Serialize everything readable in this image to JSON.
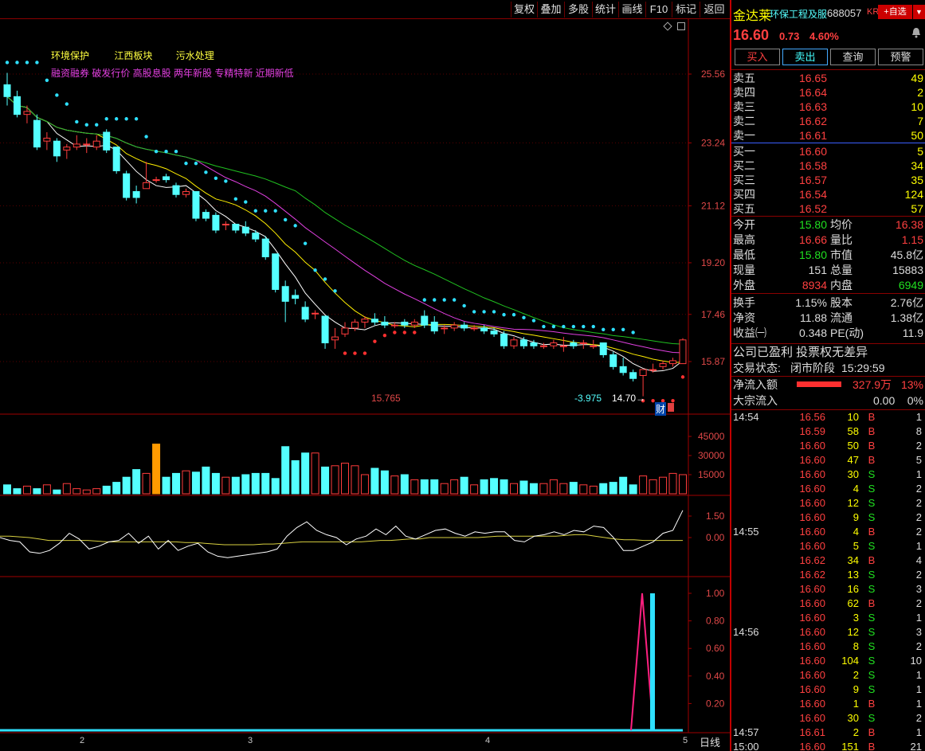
{
  "toolbar": {
    "items": [
      "复权",
      "叠加",
      "多股",
      "统计",
      "画线",
      "F10",
      "标记",
      "返回"
    ]
  },
  "chart_header": {
    "concepts": [
      "环境保护",
      "江西板块",
      "污水处理"
    ],
    "tags": "融资融券 破发行价 高股息股 两年新股 专精特新 近期新低"
  },
  "chart_annotations": {
    "low_marker": "15.765",
    "change_marker": "-3.975",
    "price_marker": "14.70→",
    "fin_badge": "财",
    "period": "日线",
    "dates": [
      "2",
      "3",
      "4",
      "5"
    ]
  },
  "chart_data": [
    {
      "type": "candlestick",
      "y_ticks": [
        "25.56",
        "23.24",
        "21.12",
        "19.20",
        "17.46",
        "15.87"
      ],
      "candles": [
        [
          25.2,
          25.6,
          24.5,
          24.8
        ],
        [
          24.8,
          25.0,
          24.1,
          24.2
        ],
        [
          24.2,
          24.5,
          23.9,
          24.3
        ],
        [
          24.0,
          24.2,
          23.0,
          23.1
        ],
        [
          23.3,
          23.6,
          23.0,
          23.4
        ],
        [
          23.3,
          23.4,
          22.6,
          22.8
        ],
        [
          23.0,
          23.2,
          22.7,
          23.1
        ],
        [
          23.1,
          23.5,
          23.0,
          23.2
        ],
        [
          23.2,
          23.4,
          22.9,
          23.2
        ],
        [
          23.1,
          23.5,
          23.0,
          23.3
        ],
        [
          23.6,
          23.7,
          22.9,
          23.0
        ],
        [
          23.1,
          23.1,
          22.2,
          22.3
        ],
        [
          22.2,
          22.3,
          21.3,
          21.4
        ],
        [
          21.6,
          21.8,
          21.2,
          21.4
        ],
        [
          21.7,
          22.6,
          21.7,
          21.9
        ],
        [
          22.0,
          22.1,
          21.9,
          22.0
        ],
        [
          22.1,
          22.2,
          21.9,
          22.0
        ],
        [
          21.8,
          21.9,
          21.4,
          21.5
        ],
        [
          21.5,
          21.7,
          21.4,
          21.6
        ],
        [
          21.6,
          21.6,
          20.6,
          20.7
        ],
        [
          20.9,
          21.0,
          20.6,
          20.7
        ],
        [
          20.8,
          20.9,
          20.2,
          20.3
        ],
        [
          20.5,
          20.6,
          20.3,
          20.5
        ],
        [
          20.5,
          20.5,
          20.2,
          20.3
        ],
        [
          20.4,
          20.6,
          20.1,
          20.2
        ],
        [
          20.2,
          20.3,
          19.9,
          20.0
        ],
        [
          20.0,
          20.1,
          19.3,
          19.4
        ],
        [
          19.5,
          19.5,
          18.2,
          18.3
        ],
        [
          18.4,
          18.6,
          17.2,
          17.9
        ],
        [
          18.1,
          18.3,
          17.8,
          18.0
        ],
        [
          17.7,
          17.9,
          17.2,
          17.3
        ],
        [
          17.5,
          17.6,
          17.3,
          17.5
        ],
        [
          17.4,
          17.4,
          16.3,
          16.5
        ],
        [
          16.6,
          17.0,
          16.3,
          16.7
        ],
        [
          16.8,
          17.2,
          16.7,
          17.0
        ],
        [
          17.0,
          17.3,
          16.9,
          17.2
        ],
        [
          17.2,
          17.4,
          17.0,
          17.3
        ],
        [
          17.3,
          17.5,
          17.1,
          17.2
        ],
        [
          17.2,
          17.4,
          17.0,
          17.1
        ],
        [
          17.1,
          17.2,
          17.0,
          17.1
        ],
        [
          17.2,
          17.3,
          17.0,
          17.1
        ],
        [
          17.1,
          17.3,
          17.0,
          17.2
        ],
        [
          17.4,
          17.6,
          17.0,
          17.1
        ],
        [
          17.2,
          17.4,
          16.8,
          16.9
        ],
        [
          17.0,
          17.1,
          16.8,
          17.0
        ],
        [
          17.0,
          17.2,
          16.9,
          17.1
        ],
        [
          17.1,
          17.2,
          16.9,
          17.0
        ],
        [
          17.0,
          17.1,
          16.9,
          17.0
        ],
        [
          17.0,
          17.1,
          16.8,
          16.9
        ],
        [
          16.9,
          17.0,
          16.7,
          16.8
        ],
        [
          16.8,
          16.9,
          16.3,
          16.4
        ],
        [
          16.4,
          16.7,
          16.3,
          16.6
        ],
        [
          16.6,
          16.7,
          16.3,
          16.4
        ],
        [
          16.5,
          16.6,
          16.3,
          16.4
        ],
        [
          16.4,
          16.5,
          16.3,
          16.4
        ],
        [
          16.4,
          16.6,
          16.3,
          16.5
        ],
        [
          16.4,
          16.7,
          16.2,
          16.4
        ],
        [
          16.5,
          16.6,
          16.3,
          16.4
        ],
        [
          16.5,
          16.6,
          16.3,
          16.5
        ],
        [
          16.4,
          16.6,
          16.3,
          16.4
        ],
        [
          16.5,
          16.5,
          16.0,
          16.1
        ],
        [
          16.1,
          16.2,
          15.6,
          15.7
        ],
        [
          15.7,
          16.0,
          15.4,
          15.5
        ],
        [
          15.5,
          15.6,
          15.2,
          15.3
        ],
        [
          15.4,
          15.6,
          14.7,
          15.6
        ],
        [
          15.6,
          15.8,
          15.5,
          15.6
        ],
        [
          15.7,
          15.9,
          15.6,
          15.8
        ],
        [
          15.8,
          16.0,
          15.7,
          15.9
        ],
        [
          15.8,
          16.66,
          15.8,
          16.6
        ]
      ]
    },
    {
      "type": "bar",
      "name": "volume",
      "y_ticks": [
        "45000",
        "30000",
        "15000"
      ],
      "values": [
        7,
        4,
        6,
        4,
        7,
        3,
        8,
        4,
        3,
        4,
        6,
        9,
        13,
        19,
        16,
        39,
        13,
        16,
        18,
        17,
        21,
        16,
        13,
        13,
        15,
        16,
        16,
        12,
        37,
        26,
        32,
        32,
        21,
        22,
        24,
        22,
        15,
        20,
        18,
        14,
        15,
        11,
        11,
        11,
        8,
        11,
        13,
        7,
        11,
        12,
        11,
        8,
        10,
        8,
        8,
        11,
        8,
        9,
        7,
        6,
        8,
        9,
        13,
        7,
        14,
        11,
        13,
        16,
        15,
        15,
        16
      ]
    },
    {
      "type": "line",
      "name": "indicator",
      "y_ticks": [
        "1.50",
        "0.00"
      ],
      "series_white": [
        0,
        -0.2,
        -0.3,
        -1.0,
        -1.1,
        -0.9,
        -0.4,
        0.3,
        -0.1,
        -0.8,
        -0.6,
        -0.3,
        -0.2,
        0.3,
        -0.4,
        0.1,
        -0.8,
        -0.2,
        -0.9,
        -0.6,
        -0.4,
        -1.0,
        -1.3,
        -1.4,
        -1.3,
        -1.2,
        -1.1,
        -1.0,
        -0.8,
        0.1,
        0.7,
        1.1,
        0.5,
        0.2,
        0.0,
        -0.5,
        -0.1,
        0.1,
        0.6,
        0.2,
        0.8,
        0.1,
        -0.1,
        0.2,
        0.5,
        0.6,
        0.3,
        0.1,
        0.4,
        0.3,
        0.4,
        0.4,
        -0.2,
        -0.3,
        0.1,
        0.2,
        0.4,
        0.2,
        0.5,
        0.4,
        0.8,
        0.7,
        0.0,
        -0.9,
        -0.9,
        -0.6,
        -0.3,
        0.3,
        0.5,
        1.9
      ],
      "series_yellow": [
        0.1,
        0.1,
        0.05,
        0,
        -0.1,
        -0.2,
        -0.2,
        -0.2,
        -0.2,
        -0.2,
        -0.25,
        -0.3,
        -0.3,
        -0.3,
        -0.3,
        -0.3,
        -0.3,
        -0.3,
        -0.3,
        -0.35,
        -0.35,
        -0.4,
        -0.45,
        -0.5,
        -0.5,
        -0.5,
        -0.5,
        -0.45,
        -0.45,
        -0.4,
        -0.35,
        -0.3,
        -0.3,
        -0.3,
        -0.3,
        -0.3,
        -0.3,
        -0.3,
        -0.25,
        -0.2,
        -0.2,
        -0.15,
        -0.1,
        -0.1,
        0,
        0,
        0,
        0,
        0,
        0,
        0.05,
        0.1,
        0.1,
        0.1,
        0.1,
        0.1,
        0.1,
        0.1,
        0.15,
        0.2,
        0.2,
        0.1,
        0,
        -0.1,
        -0.15,
        -0.15,
        -0.2,
        -0.2,
        -0.2,
        -0.2,
        -0.2
      ]
    },
    {
      "type": "line",
      "name": "signal",
      "y_ticks": [
        "1.00",
        "0.80",
        "0.60",
        "0.40",
        "0.20"
      ]
    }
  ],
  "quote": {
    "name": "金达莱",
    "sector": "环保工程及服",
    "code": "688057",
    "kr": "KR",
    "add_btn": "+自选",
    "price": "16.60",
    "change": "0.73",
    "pct": "4.60%",
    "actions": [
      "买入",
      "卖出",
      "查询",
      "预警"
    ],
    "asks": [
      {
        "l": "卖五",
        "p": "16.65",
        "v": "49"
      },
      {
        "l": "卖四",
        "p": "16.64",
        "v": "2"
      },
      {
        "l": "卖三",
        "p": "16.63",
        "v": "10"
      },
      {
        "l": "卖二",
        "p": "16.62",
        "v": "7"
      },
      {
        "l": "卖一",
        "p": "16.61",
        "v": "50"
      }
    ],
    "bids": [
      {
        "l": "买一",
        "p": "16.60",
        "v": "5"
      },
      {
        "l": "买二",
        "p": "16.58",
        "v": "34"
      },
      {
        "l": "买三",
        "p": "16.57",
        "v": "35"
      },
      {
        "l": "买四",
        "p": "16.54",
        "v": "124"
      },
      {
        "l": "买五",
        "p": "16.52",
        "v": "57"
      }
    ],
    "stats": [
      {
        "l1": "今开",
        "v1": "15.80",
        "c1": "#20e020",
        "l2": "均价",
        "v2": "16.38",
        "c2": "#ff4040"
      },
      {
        "l1": "最高",
        "v1": "16.66",
        "c1": "#ff4040",
        "l2": "量比",
        "v2": "1.15",
        "c2": "#ff4040"
      },
      {
        "l1": "最低",
        "v1": "15.80",
        "c1": "#20e020",
        "l2": "市值",
        "v2": "45.8亿",
        "c2": "#dddddd"
      },
      {
        "l1": "现量",
        "v1": "151",
        "c1": "#dddddd",
        "l2": "总量",
        "v2": "15883",
        "c2": "#dddddd"
      },
      {
        "l1": "外盘",
        "v1": "8934",
        "c1": "#ff4040",
        "l2": "内盘",
        "v2": "6949",
        "c2": "#20e020"
      }
    ],
    "stats2": [
      {
        "l1": "换手",
        "v1": "1.15%",
        "l2": "股本",
        "v2": "2.76亿"
      },
      {
        "l1": "净资",
        "v1": "11.88",
        "l2": "流通",
        "v2": "1.38亿"
      },
      {
        "l1": "收益㈠",
        "v1": "0.348",
        "l2": "PE(动)",
        "v2": "11.9"
      }
    ],
    "notice": "公司已盈利 投票权无差异",
    "trade_status_label": "交易状态:",
    "trade_status": "闭市阶段",
    "trade_time": "15:29:59",
    "inflow_label": "净流入额",
    "inflow": "327.9万",
    "inflow_pct": "13%",
    "block_label": "大宗流入",
    "block": "0.00",
    "block_pct": "0%"
  },
  "ticks": [
    {
      "t": "14:54",
      "p": "16.56",
      "v": "10",
      "s": "B",
      "n": "1"
    },
    {
      "t": "",
      "p": "16.59",
      "v": "58",
      "s": "B",
      "n": "8"
    },
    {
      "t": "",
      "p": "16.60",
      "v": "50",
      "s": "B",
      "n": "2"
    },
    {
      "t": "",
      "p": "16.60",
      "v": "47",
      "s": "B",
      "n": "5"
    },
    {
      "t": "",
      "p": "16.60",
      "v": "30",
      "s": "S",
      "n": "1"
    },
    {
      "t": "",
      "p": "16.60",
      "v": "4",
      "s": "S",
      "n": "2"
    },
    {
      "t": "",
      "p": "16.60",
      "v": "12",
      "s": "S",
      "n": "2"
    },
    {
      "t": "",
      "p": "16.60",
      "v": "9",
      "s": "S",
      "n": "2"
    },
    {
      "t": "14:55",
      "p": "16.60",
      "v": "4",
      "s": "B",
      "n": "2"
    },
    {
      "t": "",
      "p": "16.60",
      "v": "5",
      "s": "S",
      "n": "1"
    },
    {
      "t": "",
      "p": "16.62",
      "v": "34",
      "s": "B",
      "n": "4"
    },
    {
      "t": "",
      "p": "16.62",
      "v": "13",
      "s": "S",
      "n": "2"
    },
    {
      "t": "",
      "p": "16.60",
      "v": "16",
      "s": "S",
      "n": "3"
    },
    {
      "t": "",
      "p": "16.60",
      "v": "62",
      "s": "B",
      "n": "2"
    },
    {
      "t": "",
      "p": "16.60",
      "v": "3",
      "s": "S",
      "n": "1"
    },
    {
      "t": "14:56",
      "p": "16.60",
      "v": "12",
      "s": "S",
      "n": "3"
    },
    {
      "t": "",
      "p": "16.60",
      "v": "8",
      "s": "S",
      "n": "2"
    },
    {
      "t": "",
      "p": "16.60",
      "v": "104",
      "s": "S",
      "n": "10"
    },
    {
      "t": "",
      "p": "16.60",
      "v": "2",
      "s": "S",
      "n": "1"
    },
    {
      "t": "",
      "p": "16.60",
      "v": "9",
      "s": "S",
      "n": "1"
    },
    {
      "t": "",
      "p": "16.60",
      "v": "1",
      "s": "B",
      "n": "1"
    },
    {
      "t": "",
      "p": "16.60",
      "v": "30",
      "s": "S",
      "n": "2"
    },
    {
      "t": "14:57",
      "p": "16.61",
      "v": "2",
      "s": "B",
      "n": "1"
    },
    {
      "t": "15:00",
      "p": "16.60",
      "v": "151",
      "s": "B",
      "n": "21"
    }
  ],
  "colors": {
    "up": "#ff3c3c",
    "down": "#54ffff",
    "accent": "#c00000",
    "green": "#20e020"
  }
}
